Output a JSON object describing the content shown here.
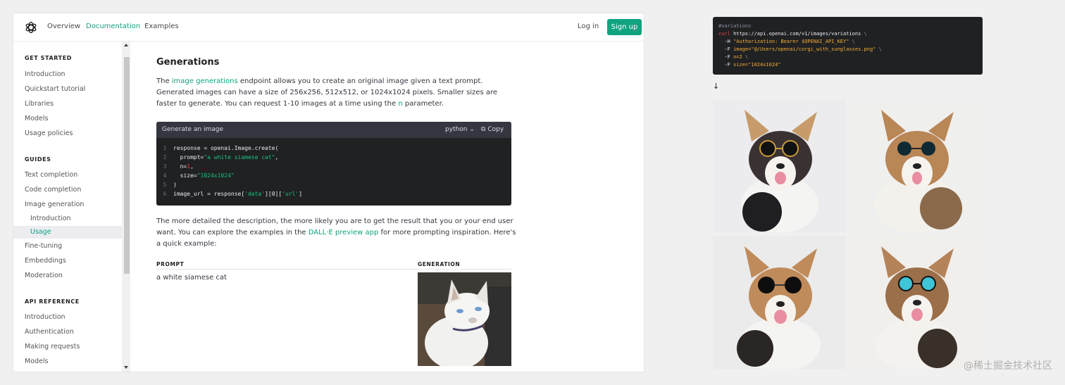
{
  "topbar": {
    "nav": [
      "Overview",
      "Documentation",
      "Examples"
    ],
    "login": "Log in",
    "signup": "Sign up"
  },
  "sidebar": {
    "get_started": {
      "heading": "GET STARTED",
      "items": [
        "Introduction",
        "Quickstart tutorial",
        "Libraries",
        "Models",
        "Usage policies"
      ]
    },
    "guides": {
      "heading": "GUIDES",
      "items": [
        "Text completion",
        "Code completion",
        "Image generation"
      ],
      "sub_items": [
        "Introduction",
        "Usage"
      ],
      "items_after": [
        "Fine-tuning",
        "Embeddings",
        "Moderation"
      ]
    },
    "api_reference": {
      "heading": "API REFERENCE",
      "items": [
        "Introduction",
        "Authentication",
        "Making requests",
        "Models"
      ]
    }
  },
  "content": {
    "title": "Generations",
    "intro_pre": "The ",
    "intro_link": "image generations",
    "intro_mid": " endpoint allows you to create an original image given a text prompt. Generated images can have a size of 256x256, 512x512, or 1024x1024 pixels. Smaller sizes are faster to generate. You can request 1-10 images at a time using the ",
    "intro_param": "n",
    "intro_post": " parameter.",
    "code_block": {
      "title": "Generate an image",
      "language": "python",
      "copy": "Copy",
      "lines": [
        {
          "n": "1",
          "text": "response = openai.Image.create("
        },
        {
          "n": "2",
          "text": "  prompt=",
          "str": "\"a white siamese cat\"",
          "tail": ","
        },
        {
          "n": "3",
          "text": "  n=",
          "num": "1",
          "tail": ","
        },
        {
          "n": "4",
          "text": "  size=",
          "str": "\"1024x1024\"",
          "tail": ""
        },
        {
          "n": "5",
          "text": ")"
        },
        {
          "n": "6",
          "text": "image_url = response[",
          "str": "'data'",
          "tail": "][0][",
          "str2": "'url'",
          "tail2": "]"
        }
      ]
    },
    "detail_pre": "The more detailed the description, the more likely you are to get the result that you or your end user want. You can explore the examples in the ",
    "detail_link": "DALL·E preview app",
    "detail_post": " for more prompting inspiration. Here's a quick example:",
    "table": {
      "headers": [
        "PROMPT",
        "GENERATION"
      ],
      "row_prompt": "a white siamese cat"
    }
  },
  "right_panel": {
    "curl_lines": [
      {
        "cmt": "#variations"
      },
      {
        "cmd": "curl",
        "text": " https://api.openai.com/v1/images/variations ",
        "bs": "\\"
      },
      {
        "text": "  -H ",
        "str": "\"Authorization: Bearer $OPENAI_API_KEY\"",
        "bs": " \\"
      },
      {
        "text": "  -F ",
        "str": "image=\"@/Users/openai/corgi_with_sunglasses.png\"",
        "bs": " \\"
      },
      {
        "text": "  -F ",
        "str": "n=2",
        "bs": " \\"
      },
      {
        "text": "  -F ",
        "str": "size=\"1024x1024\"",
        "bs": ""
      }
    ],
    "arrow": "↓"
  },
  "watermark": "@稀土掘金技术社区"
}
